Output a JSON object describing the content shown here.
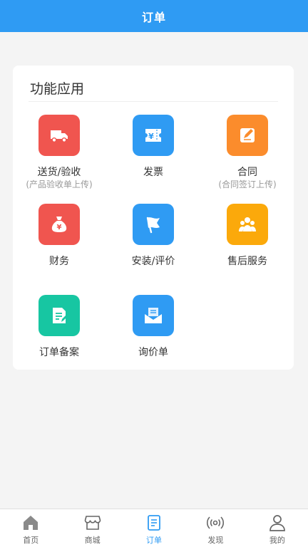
{
  "header": {
    "title": "订单"
  },
  "section": {
    "title": "功能应用"
  },
  "features": [
    {
      "label": "送货/验收",
      "sub": "(产品验收单上传)",
      "icon": "truck-icon",
      "color": "#f0554f"
    },
    {
      "label": "发票",
      "sub": "",
      "icon": "yen-ticket-icon",
      "color": "#2f9bf3"
    },
    {
      "label": "合同",
      "sub": "(合同签订上传)",
      "icon": "contract-edit-icon",
      "color": "#fb8c2c"
    },
    {
      "label": "财务",
      "sub": "",
      "icon": "money-bag-icon",
      "color": "#f0554f"
    },
    {
      "label": "安装/评价",
      "sub": "",
      "icon": "flag-icon",
      "color": "#2f9bf3"
    },
    {
      "label": "售后服务",
      "sub": "",
      "icon": "people-icon",
      "color": "#fba90b"
    },
    {
      "label": "订单备案",
      "sub": "",
      "icon": "document-edit-icon",
      "color": "#17c6a2"
    },
    {
      "label": "询价单",
      "sub": "",
      "icon": "envelope-icon",
      "color": "#2f9bf3"
    }
  ],
  "tabbar": {
    "items": [
      {
        "label": "首页",
        "icon": "home-icon"
      },
      {
        "label": "商城",
        "icon": "shop-icon"
      },
      {
        "label": "订单",
        "icon": "order-icon",
        "active": true
      },
      {
        "label": "发现",
        "icon": "broadcast-icon"
      },
      {
        "label": "我的",
        "icon": "user-icon"
      }
    ],
    "active_color": "#2f9bf3",
    "inactive_color": "#666666"
  }
}
